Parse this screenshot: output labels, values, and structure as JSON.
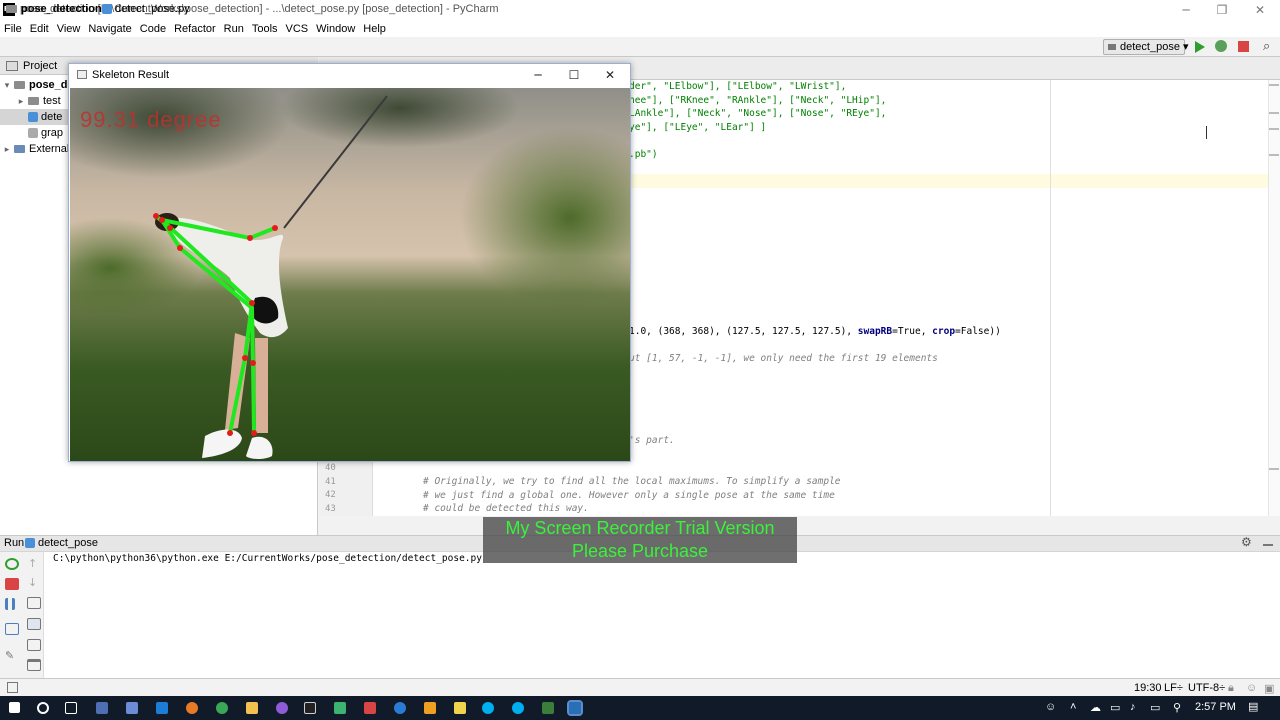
{
  "titlebar": {
    "title": "pose_detection [E:\\CurrentWorks\\pose_detection] - ...\\detect_pose.py [pose_detection] - PyCharm",
    "app_icon": "PC"
  },
  "menu": [
    "File",
    "Edit",
    "View",
    "Navigate",
    "Code",
    "Refactor",
    "Run",
    "Tools",
    "VCS",
    "Window",
    "Help"
  ],
  "nav": {
    "project": "pose_detection",
    "file": "detect_pose.py",
    "run_config": "detect_pose"
  },
  "project_panel": {
    "header": "Project",
    "items": [
      {
        "label": "pose_de",
        "arrow": "▾"
      },
      {
        "label": "test",
        "arrow": "▸"
      },
      {
        "label": "dete",
        "arrow": ""
      },
      {
        "label": "grap",
        "arrow": ""
      },
      {
        "label": "External",
        "arrow": "▸"
      }
    ]
  },
  "code": {
    "line1": "der\", \"LElbow\"], [\"LElbow\", \"LWrist\"],",
    "line2": "nee\"], [\"RKnee\", \"RAnkle\"], [\"Neck\", \"LHip\"],",
    "line3": "LAnkle\"], [\"Neck\", \"Nose\"], [\"Nose\", \"REye\"],",
    "line4": "ye\"], [\"LEye\", \"LEar\"] ]",
    "line5": ".pb\")",
    "line6a": "1.0, (368, 368), (127.5, 127.5, 127.5), ",
    "line6b_kw": "swapRB",
    "line6c": "=True, ",
    "line6d_kw": "crop",
    "line6e": "=False))",
    "line7": "ut [1, 57, -1, -1], we only need the first 19 elements",
    "line8": "'s part.",
    "c41": "# Originally, we try to find all the local maximums. To simplify a sample",
    "c42": "# we just find a global one. However only a single pose at the same time",
    "c43": "# could be detected this way.",
    "ln40": "40",
    "ln41": "41",
    "ln42": "42",
    "ln43": "43"
  },
  "run": {
    "label": "Run",
    "tab": "detect_pose",
    "console": "C:\\python\\python36\\python.exe E:/CurrentWorks/pose_detection/detect_pose.py"
  },
  "watermark": {
    "line1": "My Screen Recorder Trial Version",
    "line2": "Please Purchase"
  },
  "statusbar": {
    "position": "19:30",
    "line_sep": "LF÷",
    "encoding": "UTF-8÷"
  },
  "taskbar": {
    "time": "2:57 PM"
  },
  "skeleton_window": {
    "title": "Skeleton Result",
    "angle": "99.31 degree"
  },
  "colors": {
    "skeleton_line": "#1fe81f",
    "joint": "#e41b1b",
    "watermark_text": "#39f239"
  }
}
